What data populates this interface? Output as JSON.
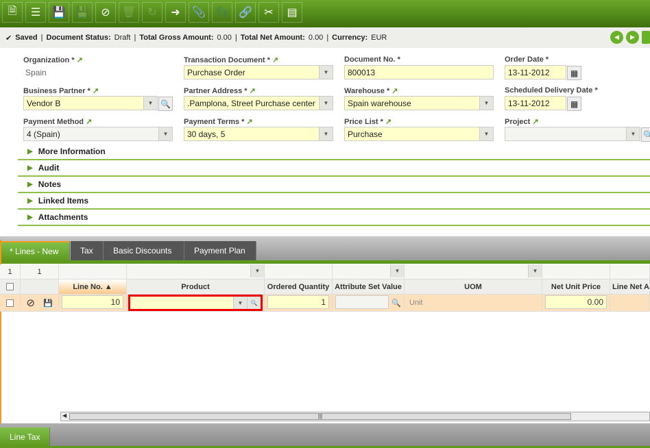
{
  "toolbar": {
    "buttons": [
      "new-document",
      "new-record",
      "save",
      "undo-close",
      "cancel",
      "delete",
      "refresh",
      "export",
      "attach",
      "audit-trail",
      "link",
      "tools",
      "toggle-view"
    ]
  },
  "status": {
    "saved": "Saved",
    "doc_status_label": "Document Status:",
    "doc_status": "Draft",
    "gross_label": "Total Gross Amount:",
    "gross": "0.00",
    "net_label": "Total Net Amount:",
    "net": "0.00",
    "currency_label": "Currency:",
    "currency": "EUR"
  },
  "form": {
    "organization": {
      "label": "Organization *",
      "value": "Spain"
    },
    "transaction_document": {
      "label": "Transaction Document *",
      "value": "Purchase Order"
    },
    "document_no": {
      "label": "Document No. *",
      "value": "800013"
    },
    "order_date": {
      "label": "Order Date *",
      "value": "13-11-2012"
    },
    "business_partner": {
      "label": "Business Partner *",
      "value": "Vendor B"
    },
    "partner_address": {
      "label": "Partner Address *",
      "value": ".Pamplona, Street Purchase center"
    },
    "warehouse": {
      "label": "Warehouse *",
      "value": "Spain warehouse"
    },
    "scheduled_delivery": {
      "label": "Scheduled Delivery Date *",
      "value": "13-11-2012"
    },
    "payment_method": {
      "label": "Payment Method",
      "value": "4 (Spain)"
    },
    "payment_terms": {
      "label": "Payment Terms *",
      "value": "30 days, 5"
    },
    "price_list": {
      "label": "Price List *",
      "value": "Purchase"
    },
    "project": {
      "label": "Project",
      "value": ""
    }
  },
  "sections": [
    "More Information",
    "Audit",
    "Notes",
    "Linked Items",
    "Attachments"
  ],
  "tabs": [
    "* Lines - New",
    "Tax",
    "Basic Discounts",
    "Payment Plan"
  ],
  "grid": {
    "filter_counts": [
      "1",
      "1"
    ],
    "headers": [
      "Line No. ▲",
      "Product",
      "Ordered Quantity",
      "Attribute Set Value",
      "UOM",
      "Net Unit Price",
      "Line Net A"
    ],
    "row": {
      "line_no": "10",
      "product": "",
      "qty": "1",
      "attr": "",
      "uom": "Unit",
      "price": "0.00"
    }
  },
  "bottom_tab": "Line Tax"
}
